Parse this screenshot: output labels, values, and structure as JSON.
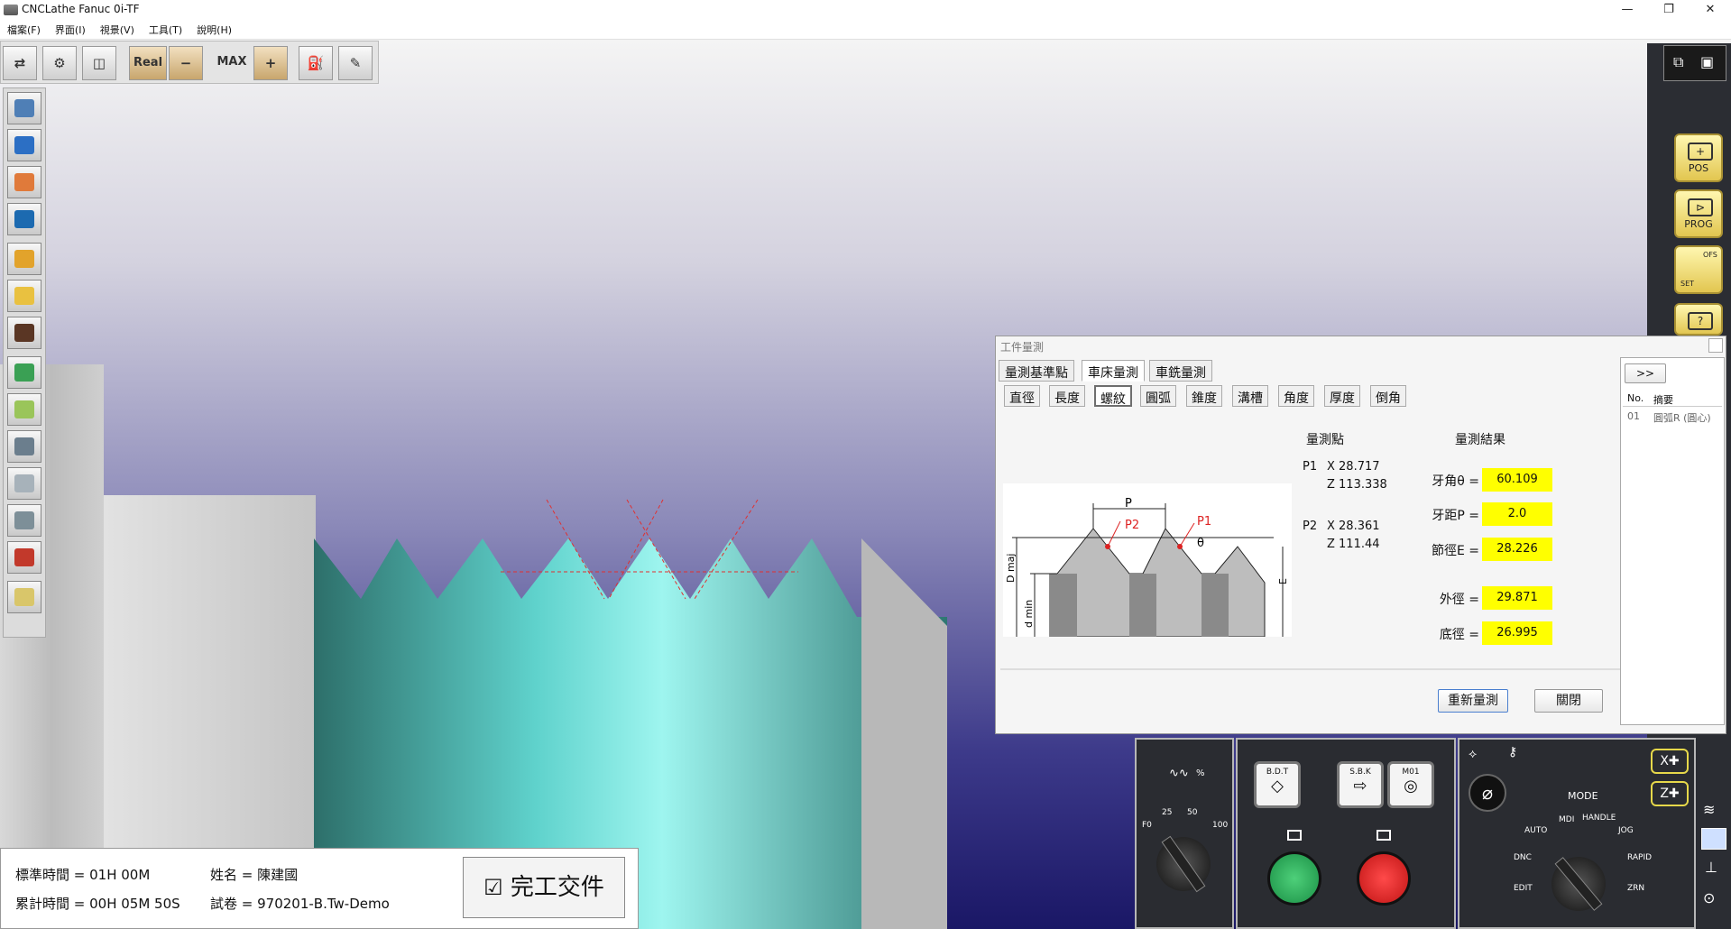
{
  "window": {
    "title": "CNCLathe Fanuc 0i-TF"
  },
  "menu": [
    "檔案(F)",
    "界面(I)",
    "視景(V)",
    "工具(T)",
    "說明(H)"
  ],
  "toolbar": {
    "real_label": "Real",
    "minus_label": "−",
    "max_label": "MAX",
    "plus_label": "+"
  },
  "right_panel": {
    "pos": "POS",
    "prog": "PROG",
    "ofs_top": "OFS",
    "ofs_bottom": "SET",
    "help": "?"
  },
  "dialog": {
    "title": "工件量測",
    "tabs": [
      "量測基準點",
      "車床量測",
      "車銑量測"
    ],
    "subtabs": [
      "直徑",
      "長度",
      "螺紋",
      "圓弧",
      "錐度",
      "溝槽",
      "角度",
      "厚度",
      "倒角"
    ],
    "points_header": "量測點",
    "results_header": "量測結果",
    "p1": {
      "label": "P1",
      "x": "X 28.717",
      "z": "Z 113.338"
    },
    "p2": {
      "label": "P2",
      "x": "X 28.361",
      "z": "Z 111.44"
    },
    "results": [
      {
        "label": "牙角θ =",
        "value": "60.109"
      },
      {
        "label": "牙距P =",
        "value": "2.0"
      },
      {
        "label": "節徑E =",
        "value": "28.226"
      },
      {
        "label": "外徑 =",
        "value": "29.871"
      },
      {
        "label": "底徑 =",
        "value": "26.995"
      }
    ],
    "diagram": {
      "p": "P",
      "p1": "P1",
      "p2": "P2",
      "theta": "θ",
      "dmaj": "D maj",
      "dmin": "d min",
      "e": "E"
    },
    "remeasure": "重新量測",
    "close": "關閉"
  },
  "side_list": {
    "expand": ">>",
    "col_no": "No.",
    "col_summary": "摘要",
    "rows": [
      {
        "no": "01",
        "summary": "圓弧R (圓心)"
      }
    ]
  },
  "feed_panel": {
    "label": "%",
    "scale": [
      "F0",
      "25",
      "50",
      "100"
    ]
  },
  "cycle_panel": {
    "bdt": "B.D.T",
    "sbk": "S.B.K",
    "m01": "M01"
  },
  "mode_panel": {
    "mode": "MODE",
    "handle": "HANDLE",
    "auto": "AUTO",
    "mdi": "MDI",
    "jog": "JOG",
    "dnc": "DNC",
    "rapid": "RAPID",
    "edit": "EDIT",
    "zrn": "ZRN",
    "x_axis": "X",
    "z_axis": "Z"
  },
  "info": {
    "std_time": "標準時間 = 01H 00M",
    "acc_time": "累計時間 = 00H 05M 50S",
    "name": "姓名 = 陳建國",
    "exam": "試卷 = 970201-B.Tw-Demo",
    "done": "完工交件"
  }
}
